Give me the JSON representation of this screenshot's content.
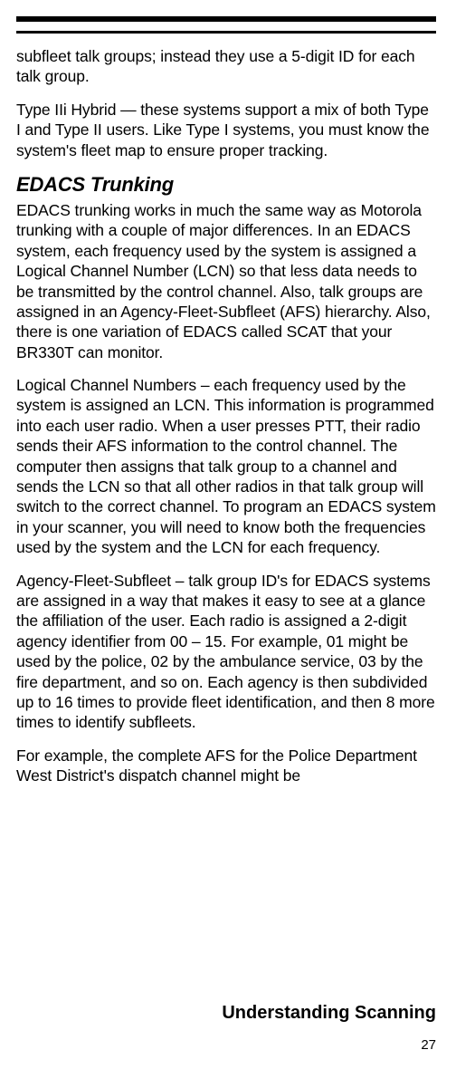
{
  "rules": {},
  "paragraphs": {
    "p1": "subfleet talk groups; instead they use a 5-digit ID for each talk group.",
    "p2": "Type IIi Hybrid — these systems support a mix of both Type I and Type II users. Like Type I systems, you must know the system's fleet map to ensure proper tracking.",
    "h2": "EDACS Trunking",
    "p3": "EDACS trunking works in much the same way as Motorola trunking with a couple of major differences. In an EDACS system, each frequency used by the system is assigned a Logical Channel Number (LCN) so that less data needs to be transmitted by the control channel. Also, talk groups are assigned in an Agency-Fleet-Subfleet (AFS) hierarchy. Also, there is one variation of EDACS called SCAT that your BR330T can monitor.",
    "p4": "Logical Channel Numbers – each frequency used by the system is assigned an LCN. This information is programmed into each user radio. When a user presses PTT, their radio sends their AFS information to the control channel. The computer then assigns that talk group to a channel and sends the LCN so that all other radios in that talk group will switch to the correct channel. To program an EDACS system in your scanner, you will need to know both the frequencies used by the system and the LCN for each frequency.",
    "p5": "Agency-Fleet-Subfleet – talk group ID's for EDACS systems are assigned in a way that makes it easy to see at a glance the affiliation of the user. Each radio is assigned a 2-digit agency identifier from 00 – 15. For example, 01 might be used by the police, 02 by the ambulance service, 03 by the fire department, and so on. Each agency is then subdivided up to 16 times to provide fleet identification, and then 8 more times to identify subfleets.",
    "p6": "For example, the complete AFS for the Police Department West District's dispatch channel might be"
  },
  "footer": {
    "title": "Understanding Scanning",
    "page": "27"
  }
}
